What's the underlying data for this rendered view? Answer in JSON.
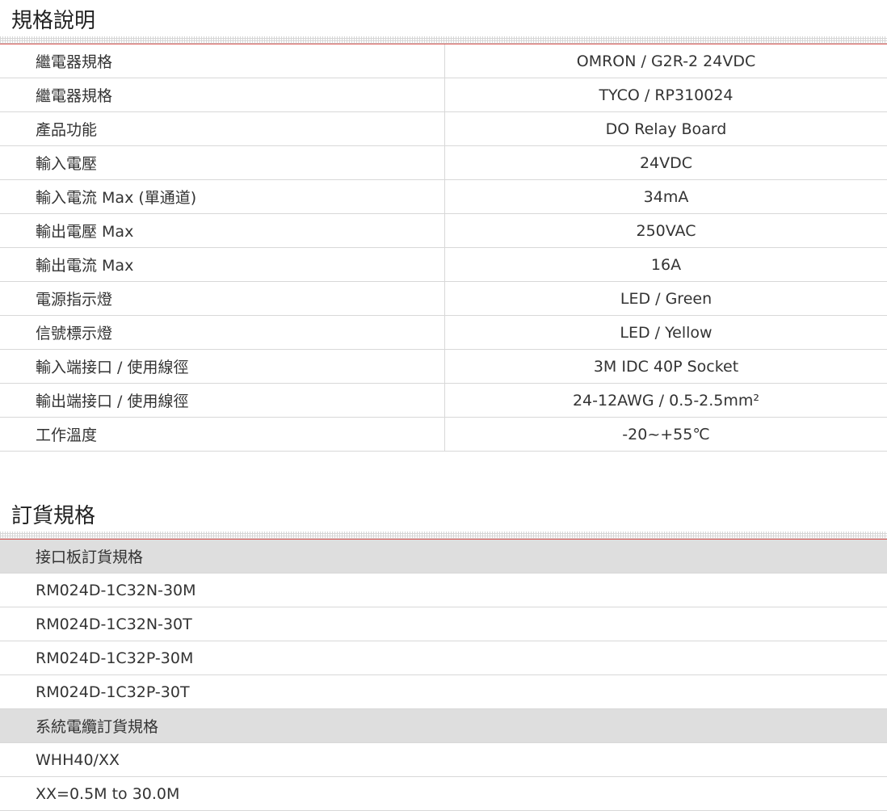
{
  "spec": {
    "title": "規格說明",
    "rows": [
      {
        "key": "繼電器規格",
        "value": "OMRON / G2R-2 24VDC"
      },
      {
        "key": "繼電器規格",
        "value": "TYCO / RP310024"
      },
      {
        "key": "產品功能",
        "value": "DO Relay Board"
      },
      {
        "key": "輸入電壓",
        "value": "24VDC"
      },
      {
        "key": "輸入電流 Max (單通道)",
        "value": "34mA"
      },
      {
        "key": "輸出電壓 Max",
        "value": "250VAC"
      },
      {
        "key": "輸出電流 Max",
        "value": "16A"
      },
      {
        "key": "電源指示燈",
        "value": "LED / Green"
      },
      {
        "key": "信號標示燈",
        "value": "LED / Yellow"
      },
      {
        "key": "輸入端接口 / 使用線徑",
        "value": "3M IDC 40P Socket"
      },
      {
        "key": "輸出端接口 / 使用線徑",
        "value": "24-12AWG / 0.5-2.5mm²"
      },
      {
        "key": "工作溫度",
        "value": "-20~+55℃"
      }
    ]
  },
  "order": {
    "title": "訂貨規格",
    "groups": [
      {
        "header": "接口板訂貨規格",
        "items": [
          "RM024D-1C32N-30M",
          "RM024D-1C32N-30T",
          "RM024D-1C32P-30M",
          "RM024D-1C32P-30T"
        ]
      },
      {
        "header": "系統電纜訂貨規格",
        "items": [
          "WHH40/XX",
          "XX=0.5M to 30.0M"
        ]
      }
    ]
  }
}
